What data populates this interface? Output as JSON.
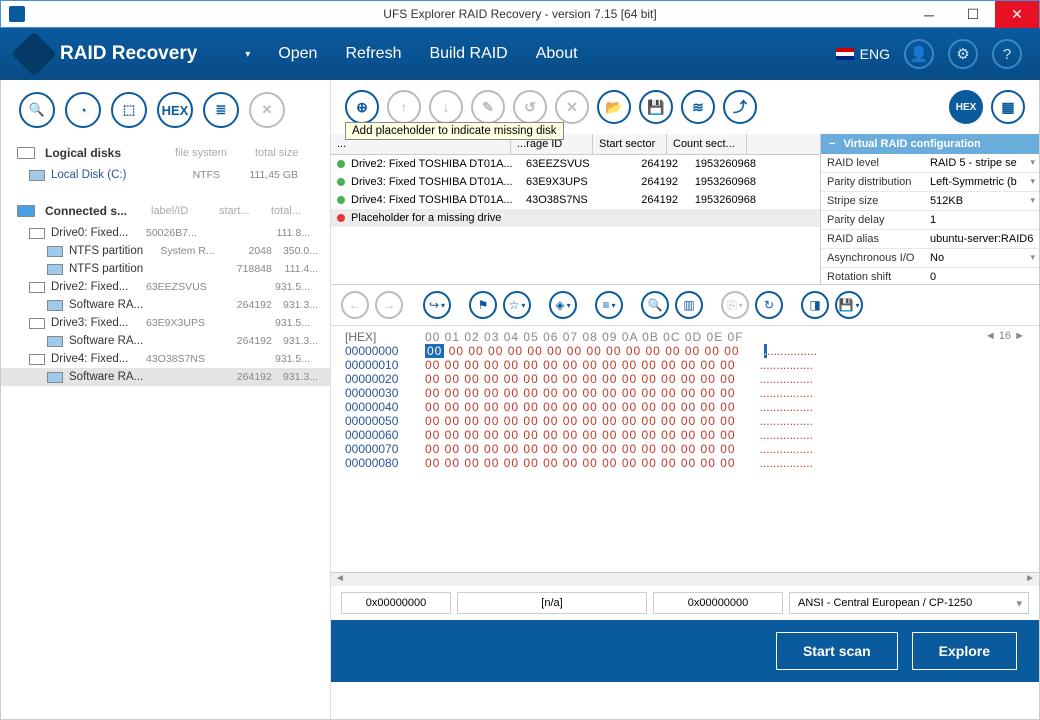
{
  "title": "UFS Explorer RAID Recovery - version 7.15 [64 bit]",
  "logo": "RAID Recovery",
  "menu": {
    "open": "Open",
    "refresh": "Refresh",
    "build": "Build RAID",
    "about": "About"
  },
  "lang": "ENG",
  "tooltip": "Add placeholder to indicate missing disk",
  "left": {
    "logical": {
      "title": "Logical disks",
      "col1": "file system",
      "col2": "total size"
    },
    "localdisk": {
      "name": "Local Disk (C:)",
      "fs": "NTFS",
      "size": "111,45 GB"
    },
    "connected": {
      "title": "Connected s...",
      "c1": "label/ID",
      "c2": "start...",
      "c3": "total..."
    },
    "rows": [
      {
        "name": "Drive0: Fixed...",
        "c1": "50026B7...",
        "c2": "",
        "c3": "111.8..."
      },
      {
        "sub": true,
        "name": "NTFS partition",
        "c1": "System R...",
        "c2": "2048",
        "c3": "350.0..."
      },
      {
        "sub": true,
        "name": "NTFS partition",
        "c1": "",
        "c2": "718848",
        "c3": "111.4..."
      },
      {
        "name": "Drive2: Fixed...",
        "c1": "63EEZSVUS",
        "c2": "",
        "c3": "931.5..."
      },
      {
        "sub": true,
        "name": "Software RA...",
        "c1": "",
        "c2": "264192",
        "c3": "931.3..."
      },
      {
        "name": "Drive3: Fixed...",
        "c1": "63E9X3UPS",
        "c2": "",
        "c3": "931.5..."
      },
      {
        "sub": true,
        "name": "Software RA...",
        "c1": "",
        "c2": "264192",
        "c3": "931.3..."
      },
      {
        "name": "Drive4: Fixed...",
        "c1": "43O38S7NS",
        "c2": "",
        "c3": "931.5..."
      },
      {
        "sub": true,
        "sel": true,
        "name": "Software RA...",
        "c1": "",
        "c2": "264192",
        "c3": "931.3..."
      }
    ]
  },
  "storage": {
    "hdr": {
      "name": "...",
      "id": "...rage ID",
      "start": "Start sector",
      "count": "Count sect..."
    },
    "rows": [
      {
        "dot": "g",
        "name": "Drive2: Fixed TOSHIBA DT01A...",
        "id": "63EEZSVUS",
        "start": "264192",
        "count": "1953260968"
      },
      {
        "dot": "g",
        "name": "Drive3: Fixed TOSHIBA DT01A...",
        "id": "63E9X3UPS",
        "start": "264192",
        "count": "1953260968"
      },
      {
        "dot": "g",
        "name": "Drive4: Fixed TOSHIBA DT01A...",
        "id": "43O38S7NS",
        "start": "264192",
        "count": "1953260968"
      },
      {
        "dot": "r",
        "sel": true,
        "name": "Placeholder for a missing drive",
        "id": "",
        "start": "",
        "count": ""
      }
    ]
  },
  "config": {
    "title": "Virtual RAID configuration",
    "rows": [
      {
        "lbl": "RAID level",
        "val": "RAID 5 - stripe se",
        "dd": true
      },
      {
        "lbl": "Parity distribution",
        "val": "Left-Symmetric (b",
        "dd": true
      },
      {
        "lbl": "Stripe size",
        "val": "512KB",
        "dd": true
      },
      {
        "lbl": "Parity delay",
        "val": "1"
      },
      {
        "lbl": "RAID alias",
        "val": "ubuntu-server:RAID6"
      },
      {
        "lbl": "Asynchronous I/O",
        "val": "No",
        "dd": true
      },
      {
        "lbl": "Rotation shift value",
        "val": "0"
      }
    ]
  },
  "hex": {
    "label": "[HEX]",
    "cols": "00 01 02 03 04 05 06 07 08 09 0A 0B 0C 0D 0E 0F",
    "nav": "◄  16  ►",
    "offsets": [
      "00000000",
      "00000010",
      "00000020",
      "00000030",
      "00000040",
      "00000050",
      "00000060",
      "00000070",
      "00000080"
    ],
    "rowbytes": "00 00 00 00 00 00 00 00 00 00 00 00 00 00 00 00",
    "rowbytes_first_rest": "00 00 00 00 00 00 00 00 00 00 00 00 00 00 00",
    "ascii": "................"
  },
  "status": {
    "off": "0x00000000",
    "na": "[n/a]",
    "sel": "0x00000000",
    "enc": "ANSI - Central European / CP-1250"
  },
  "footer": {
    "scan": "Start scan",
    "explore": "Explore"
  }
}
